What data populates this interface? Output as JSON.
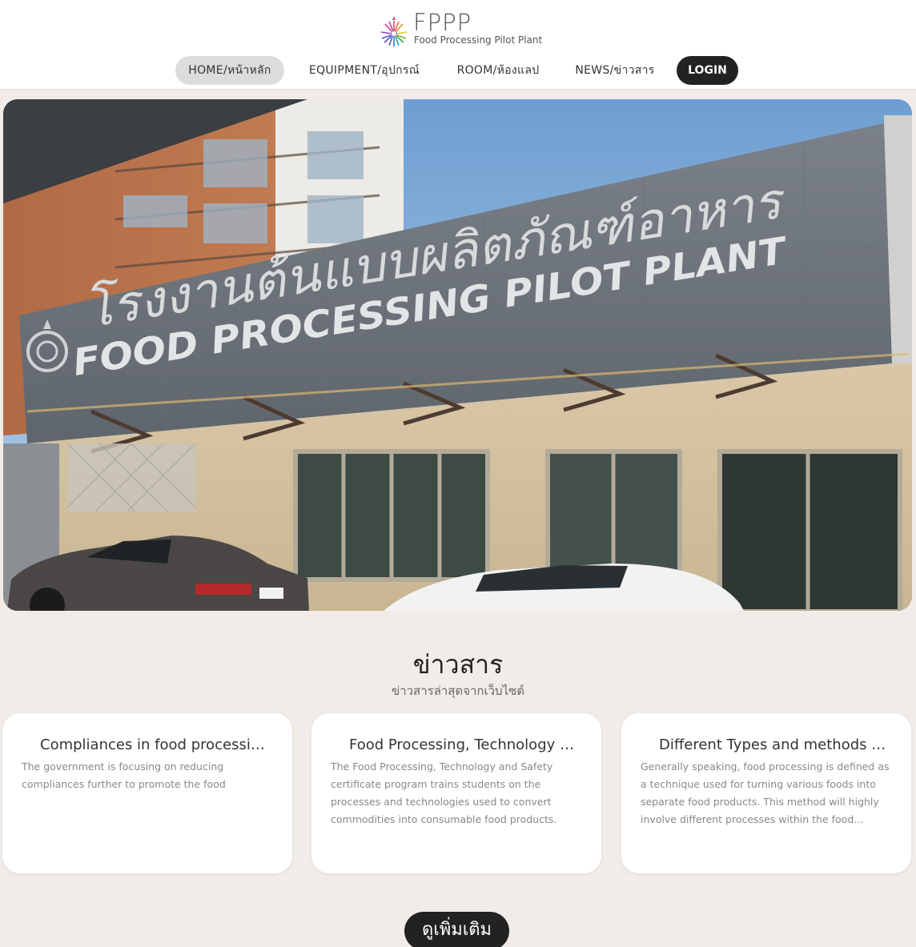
{
  "brand": {
    "title": "FPPP",
    "subtitle": "Food Processing Pilot Plant",
    "logo_icon": "radial-flower-logo-icon"
  },
  "nav": {
    "items": [
      {
        "label": "HOME/หน้าหลัก",
        "active": true
      },
      {
        "label": "EQUIPMENT/อุปกรณ์",
        "active": false
      },
      {
        "label": "ROOM/ห้องแลป",
        "active": false
      },
      {
        "label": "NEWS/ข่าวสาร",
        "active": false
      }
    ],
    "login_label": "LOGIN"
  },
  "hero": {
    "sign_thai": "โรงงานต้นแบบผลิตภัณฑ์อาหาร",
    "sign_english": "FOOD PROCESSING PILOT PLANT"
  },
  "news": {
    "title": "ข่าวสาร",
    "subtitle": "ข่าวสารล่าสุดจากเว็บไซต์",
    "cards": [
      {
        "title": "Compliances in food processing",
        "body": "The government is focusing on reducing compliances further to promote the food"
      },
      {
        "title": "Food Processing, Technology and Safety",
        "body": "The Food Processing, Technology and Safety certificate program trains students on the processes and technologies used to convert commodities into consumable food products."
      },
      {
        "title": "Different Types and methods in food processing",
        "body": "Generally speaking, food processing is defined as a technique used for turning various foods into separate food products. This method will highly involve different processes within the food…"
      }
    ],
    "more_label": "ดูเพิ่มเติม"
  },
  "colors": {
    "page_bg": "#f1ece8",
    "header_bg": "#ffffff",
    "dark_button": "#222222",
    "active_nav_bg": "#dcdcdc"
  }
}
